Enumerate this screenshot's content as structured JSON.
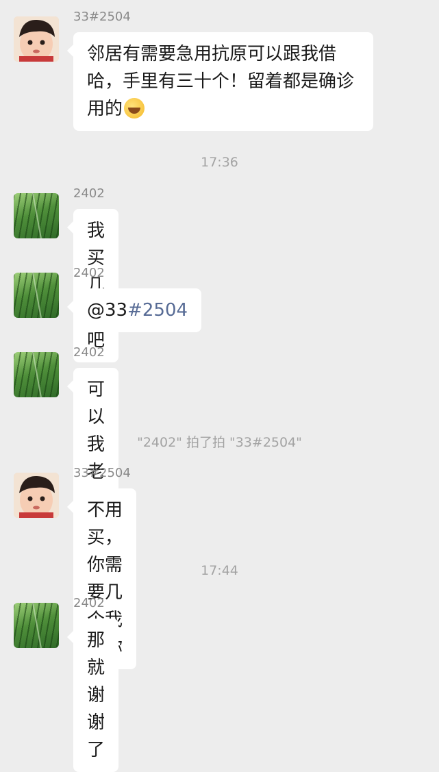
{
  "messages": [
    {
      "sender": "33#2504",
      "text": "邻居有需要急用抗原可以跟我借哈，手里有三十个！留着都是确诊用的",
      "emoji": "face-with-tears-of-joy-icon"
    },
    {
      "sender": "2402",
      "text": "我买几个吧"
    },
    {
      "sender": "2402",
      "mention_prefix": "@33",
      "mention_highlight": "#2504"
    },
    {
      "sender": "2402",
      "text": "可以我老婆上去拿"
    },
    {
      "sender": "33#2504",
      "text": "不用买，你需要几个我给你"
    },
    {
      "sender": "2402",
      "text": "那就谢谢了"
    }
  ],
  "times": [
    "17:36",
    "17:44"
  ],
  "pat_notice": "\"2402\" 拍了拍 \"33#2504\""
}
